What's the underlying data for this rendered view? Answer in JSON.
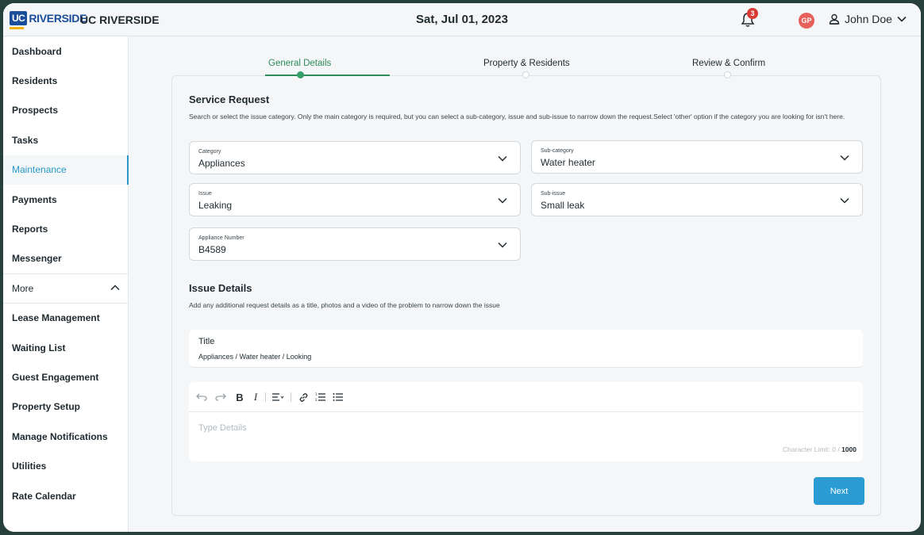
{
  "header": {
    "logo_uc": "UC",
    "logo_text": "RIVERSIDE",
    "org_name": "UC RIVERSIDE",
    "date": "Sat, Jul 01, 2023",
    "notification_count": "3",
    "avatar_initials": "GP",
    "user_name": "John Doe"
  },
  "sidebar": {
    "items": [
      {
        "label": "Dashboard"
      },
      {
        "label": "Residents"
      },
      {
        "label": "Prospects"
      },
      {
        "label": "Tasks"
      },
      {
        "label": "Maintenance",
        "active": true
      },
      {
        "label": "Payments"
      },
      {
        "label": "Reports"
      },
      {
        "label": "Messenger"
      }
    ],
    "more_label": "More",
    "more_items": [
      {
        "label": "Lease Management"
      },
      {
        "label": "Waiting List"
      },
      {
        "label": "Guest Engagement"
      },
      {
        "label": "Property Setup"
      },
      {
        "label": "Manage Notifications"
      },
      {
        "label": "Utilities"
      },
      {
        "label": "Rate Calendar"
      }
    ]
  },
  "stepper": {
    "steps": [
      {
        "label": "General Details",
        "state": "active"
      },
      {
        "label": "Property & Residents",
        "state": "pending"
      },
      {
        "label": "Review & Confirm",
        "state": "pending"
      }
    ]
  },
  "service_request": {
    "title": "Service Request",
    "description": "Search or select the issue category. Only the main category is required, but you can select a sub-category, issue and sub-issue to narrow down the request.Select 'other' option if the category you are looking for isn't here.",
    "fields": {
      "category": {
        "label": "Category",
        "value": "Appliances"
      },
      "sub_category": {
        "label": "Sub-category",
        "value": "Water heater"
      },
      "issue": {
        "label": "Issue",
        "value": "Leaking"
      },
      "sub_issue": {
        "label": "Sub-issue",
        "value": "Small leak"
      },
      "appliance_number": {
        "label": "Appliance Number",
        "value": "B4589"
      }
    }
  },
  "issue_details": {
    "title": "Issue Details",
    "description": "Add any additional request details as a title, photos and a video of the problem to narrow down the issue",
    "title_field": {
      "label": "Title",
      "value": "Appliances / Water heater / Looking"
    },
    "editor": {
      "placeholder": "Type Details",
      "char_limit_label": "Character Limit: 0 /",
      "char_limit_max": "1000"
    }
  },
  "actions": {
    "next_label": "Next"
  },
  "colors": {
    "accent": "#2997c9",
    "step_active": "#2e8b5a",
    "badge": "#d93c35",
    "avatar": "#e8605a",
    "brand": "#1a4e9c"
  }
}
